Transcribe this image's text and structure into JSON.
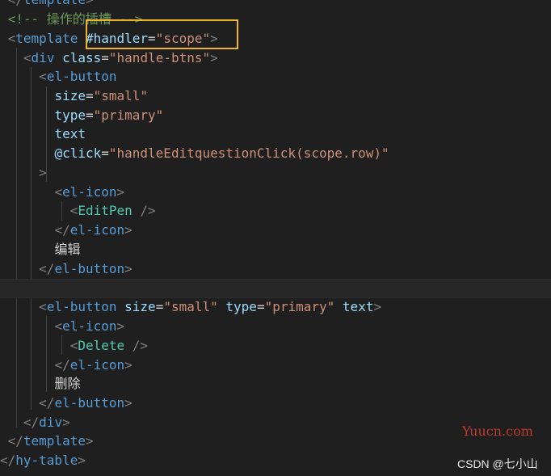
{
  "lines": {
    "l0": {
      "close_template": "template"
    },
    "l1": {
      "comment": "<!-- 操作的插槽 -->"
    },
    "l2": {
      "tag": "template",
      "attr": "#handler",
      "eq": "=",
      "val": "\"scope\""
    },
    "l3": {
      "tag": "div",
      "attr": "class",
      "eq": "=",
      "val": "\"handle-btns\""
    },
    "l4": {
      "tag": "el-button"
    },
    "l5": {
      "attr": "size",
      "eq": "=",
      "val": "\"small\""
    },
    "l6": {
      "attr": "type",
      "eq": "=",
      "val": "\"primary\""
    },
    "l7": {
      "attr": "text"
    },
    "l8": {
      "attr": "@click",
      "eq": "=",
      "val": "\"handleEditquestionClick(scope.row)\""
    },
    "l9": {
      "bracket": ">"
    },
    "l10": {
      "tag": "el-icon"
    },
    "l11": {
      "comp": "EditPen"
    },
    "l12": {
      "tag": "el-icon"
    },
    "l13": {
      "text": "编辑"
    },
    "l14": {
      "tag": "el-button"
    },
    "l16": {
      "tag": "el-button",
      "a1": "size",
      "v1": "\"small\"",
      "a2": "type",
      "v2": "\"primary\"",
      "a3": "text"
    },
    "l17": {
      "tag": "el-icon"
    },
    "l18": {
      "comp": "Delete"
    },
    "l19": {
      "tag": "el-icon"
    },
    "l20": {
      "text": "删除"
    },
    "l21": {
      "tag": "el-button"
    },
    "l22": {
      "tag": "div"
    },
    "l23": {
      "tag": "template"
    },
    "l24": {
      "tag": "hy-table"
    }
  },
  "watermarks": {
    "yuucn": "Yuucn.com",
    "csdn": "CSDN @七小山"
  },
  "colors": {
    "highlight": "#f0b429",
    "tag": "#569cd6",
    "attr": "#9cdcfe",
    "string": "#ce9178",
    "comment": "#6a9955",
    "component": "#4ec9b0"
  }
}
